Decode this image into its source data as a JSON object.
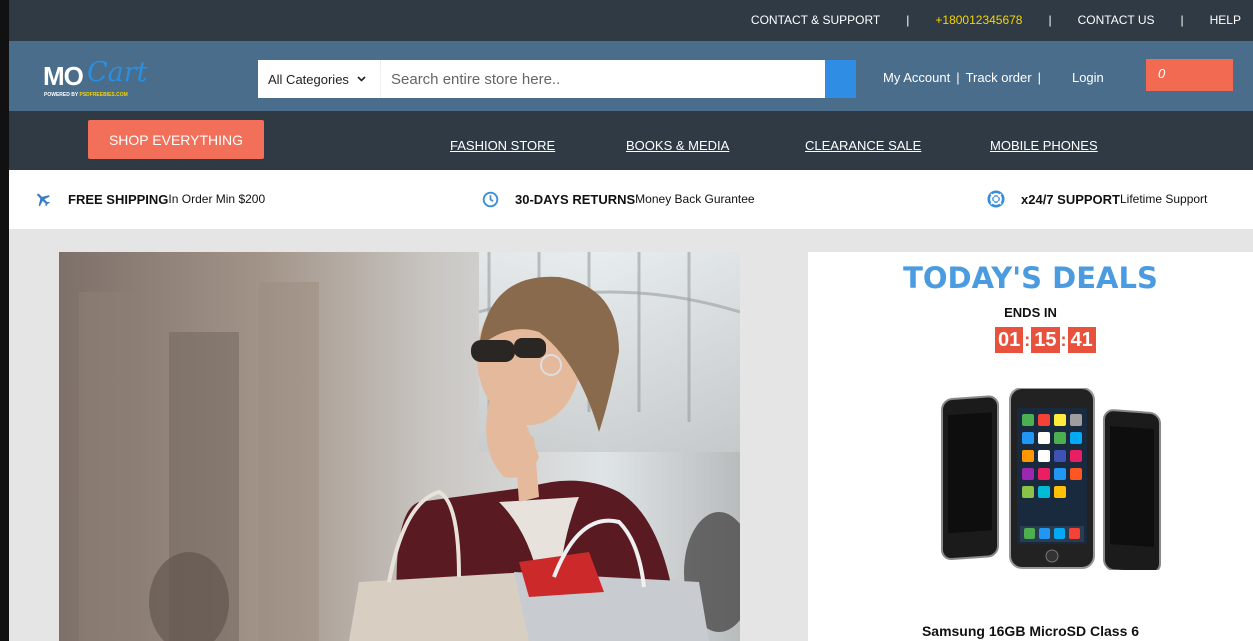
{
  "topbar": {
    "contact_support": "CONTACT & SUPPORT",
    "phone": "+180012345678",
    "contact_us": "CONTACT US",
    "help": "HELP",
    "separator": "|"
  },
  "logo": {
    "mo": "MO",
    "cart": "Cart",
    "powered_prefix": "POWERED BY",
    "powered_site": "PSDFREEBIES.COM"
  },
  "search": {
    "category": "All Categories",
    "placeholder": "Search entire store here.."
  },
  "account": {
    "my_account": "My Account",
    "track_order": "Track order",
    "login": "Login",
    "separator": "|",
    "cart_count": "0"
  },
  "nav": {
    "shop_everything": "SHOP EVERYTHING",
    "links": [
      "FASHION STORE",
      "BOOKS & MEDIA",
      "CLEARANCE SALE",
      "MOBILE PHONES"
    ]
  },
  "features": [
    {
      "title": "FREE SHIPPING",
      "sub": "In Order Min $200",
      "icon": "airplane-icon"
    },
    {
      "title": "30-DAYS RETURNS",
      "sub": "Money Back Gurantee",
      "icon": "clock-icon"
    },
    {
      "title": "x24/7 SUPPORT",
      "sub": "Lifetime Support",
      "icon": "lifebuoy-icon"
    }
  ],
  "deals": {
    "title": "TODAY'S DEALS",
    "ends_in": "ENDS IN",
    "timer": [
      "01",
      "15",
      "41"
    ],
    "timer_sep": ":",
    "product_name": "Samsung 16GB MicroSD Class 6"
  },
  "colors": {
    "topbar": "#2f3a45",
    "header": "#4a6d8c",
    "accent_orange": "#f2705a",
    "accent_blue": "#2f8de4",
    "phone_yellow": "#f5d400",
    "deals_blue": "#4a9be0",
    "timer_red": "#e8513b"
  }
}
